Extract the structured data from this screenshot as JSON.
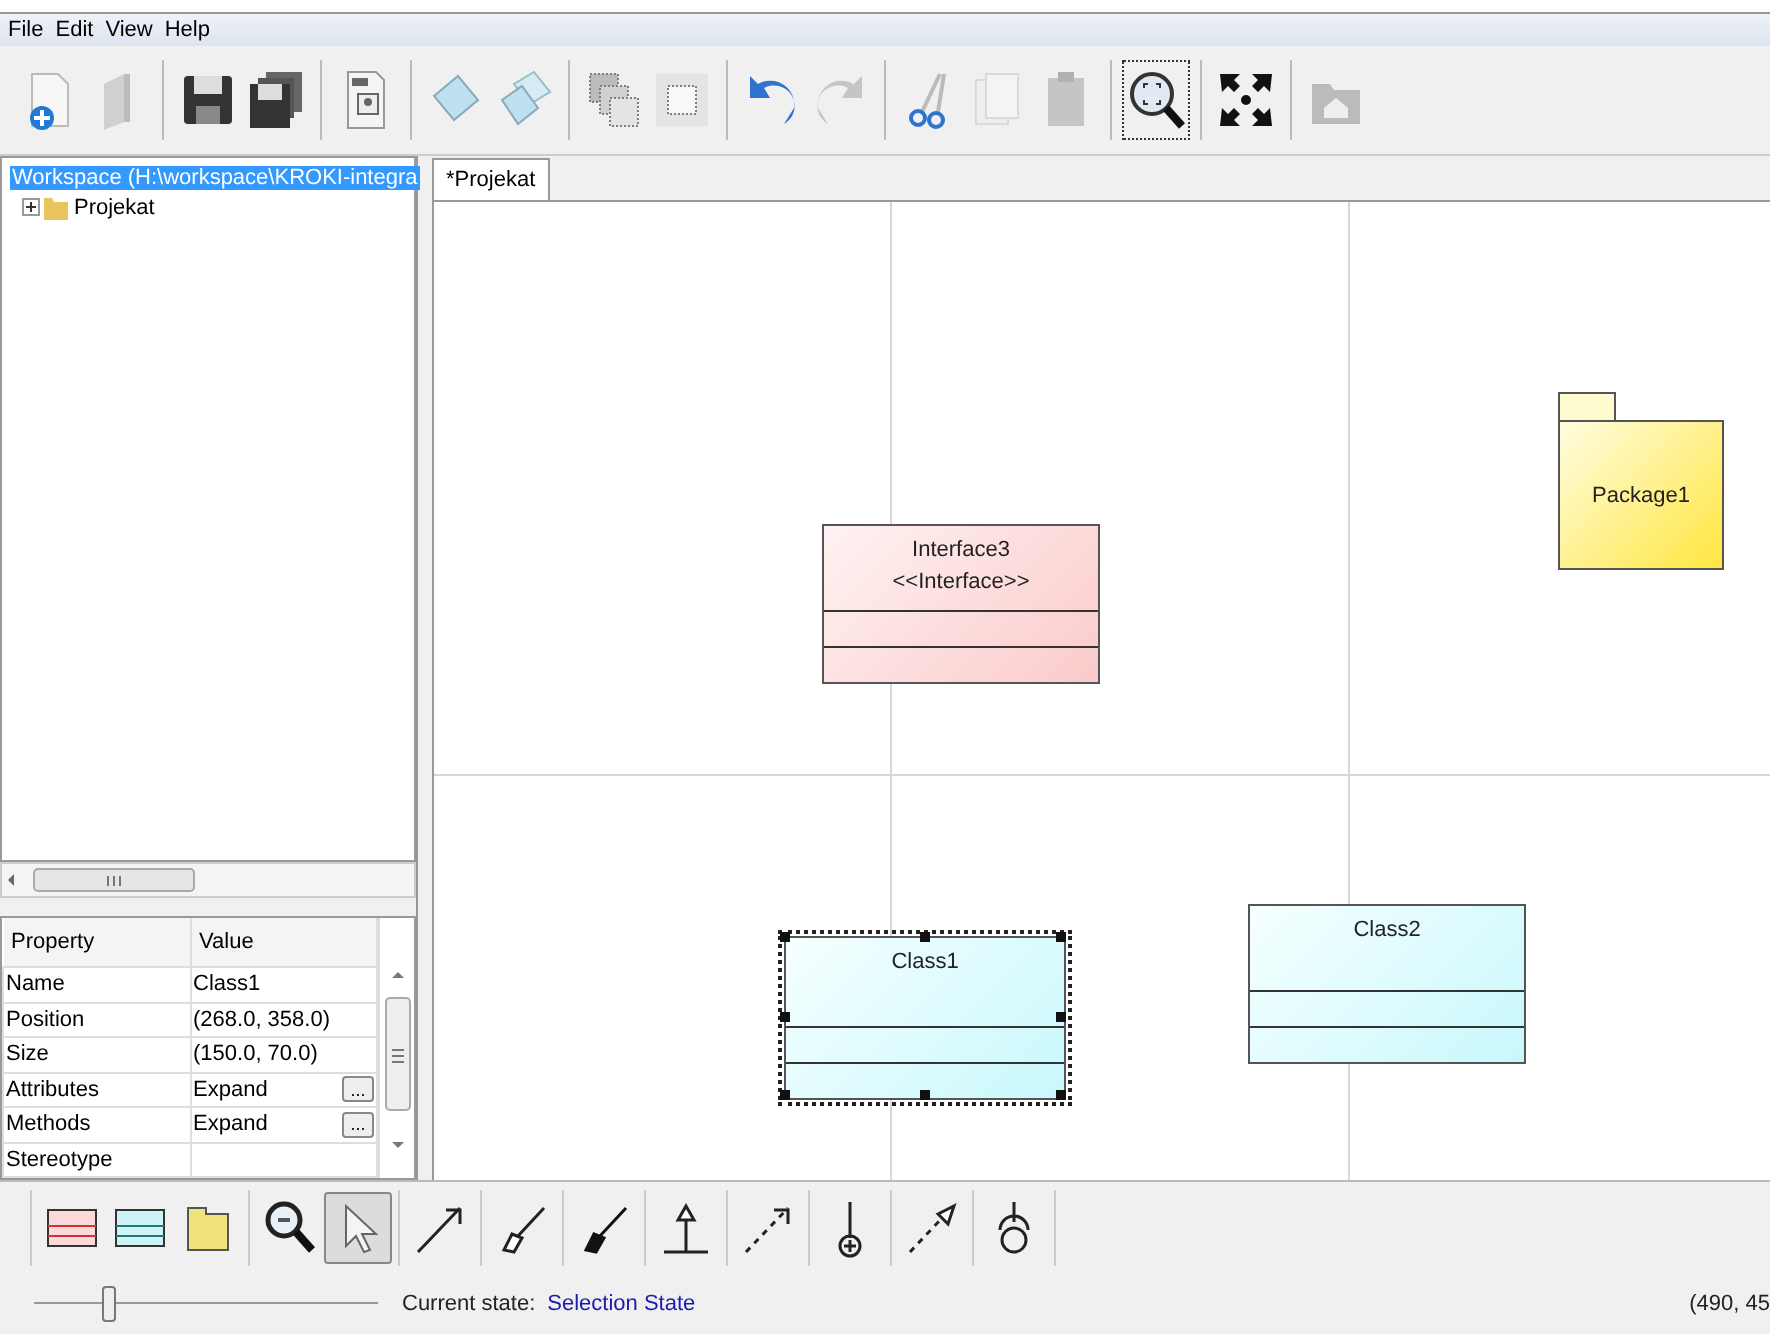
{
  "menu": [
    "File",
    "Edit",
    "View",
    "Help"
  ],
  "toolbar": [
    [
      {
        "kind": "new",
        "disabled": false
      },
      {
        "kind": "open",
        "disabled": true
      }
    ],
    [
      {
        "kind": "save",
        "disabled": false
      },
      {
        "kind": "save-all",
        "disabled": false
      }
    ],
    [
      {
        "kind": "export",
        "disabled": false
      }
    ],
    [
      {
        "kind": "sheet",
        "disabled": false
      },
      {
        "kind": "sheets",
        "disabled": false
      }
    ],
    [
      {
        "kind": "stack",
        "disabled": true
      },
      {
        "kind": "frame",
        "disabled": true
      }
    ],
    [
      {
        "kind": "undo",
        "disabled": false
      },
      {
        "kind": "redo",
        "disabled": true
      }
    ],
    [
      {
        "kind": "cut",
        "disabled": false
      },
      {
        "kind": "copy",
        "disabled": true
      },
      {
        "kind": "paste",
        "disabled": true
      }
    ],
    [
      {
        "kind": "zoom-fit",
        "disabled": false
      }
    ],
    [
      {
        "kind": "expand",
        "disabled": false
      }
    ],
    [
      {
        "kind": "home",
        "disabled": true
      }
    ]
  ],
  "tree": [
    {
      "label": "Workspace (H:\\workspace\\KROKI-integra",
      "selected": true,
      "children": [
        {
          "label": "Projekat",
          "selected": false,
          "expanded": false
        }
      ]
    }
  ],
  "properties": {
    "columns": [
      "Property",
      "Value"
    ],
    "rows": [
      {
        "name": "Name",
        "value": "Class1",
        "kind": "text"
      },
      {
        "name": "Position",
        "value": "(268.0, 358.0)",
        "kind": "text"
      },
      {
        "name": "Size",
        "value": "(150.0, 70.0)",
        "kind": "text"
      },
      {
        "name": "Attributes",
        "value": "Expand",
        "kind": "button",
        "button": "..."
      },
      {
        "name": "Methods",
        "value": "Expand",
        "kind": "button",
        "button": "..."
      },
      {
        "name": "Stereotype",
        "kind": "text"
      }
    ]
  },
  "tabs": [
    {
      "label": "*Projekat",
      "selected": true
    }
  ],
  "diagram": {
    "elements": [
      {
        "kind": "interface",
        "name": "Interface3",
        "stereotype": "<<Interface>>",
        "selected": false
      },
      {
        "kind": "package",
        "name": "Package1",
        "selected": false
      },
      {
        "kind": "class",
        "name": "Class1",
        "selected": true
      },
      {
        "kind": "class",
        "name": "Class2",
        "selected": false
      }
    ]
  },
  "palette": [
    [
      {
        "kind": "interface",
        "selected": false
      },
      {
        "kind": "class",
        "selected": false
      },
      {
        "kind": "package",
        "selected": false
      }
    ],
    [
      {
        "kind": "zoom",
        "selected": false
      },
      {
        "kind": "select",
        "selected": true
      }
    ],
    [
      {
        "kind": "association",
        "selected": false
      }
    ],
    [
      {
        "kind": "aggregation",
        "selected": false
      }
    ],
    [
      {
        "kind": "composition",
        "selected": false
      }
    ],
    [
      {
        "kind": "generalization",
        "selected": false
      }
    ],
    [
      {
        "kind": "dependency",
        "selected": false
      }
    ],
    [
      {
        "kind": "nesting",
        "selected": false
      }
    ],
    [
      {
        "kind": "realization",
        "selected": false
      }
    ],
    [
      {
        "kind": "required",
        "selected": false
      }
    ]
  ],
  "status": {
    "zoom": {
      "level": 0.2
    },
    "state_label": "Current state:",
    "state": "Selection State",
    "coordinates": "(490, 45"
  }
}
